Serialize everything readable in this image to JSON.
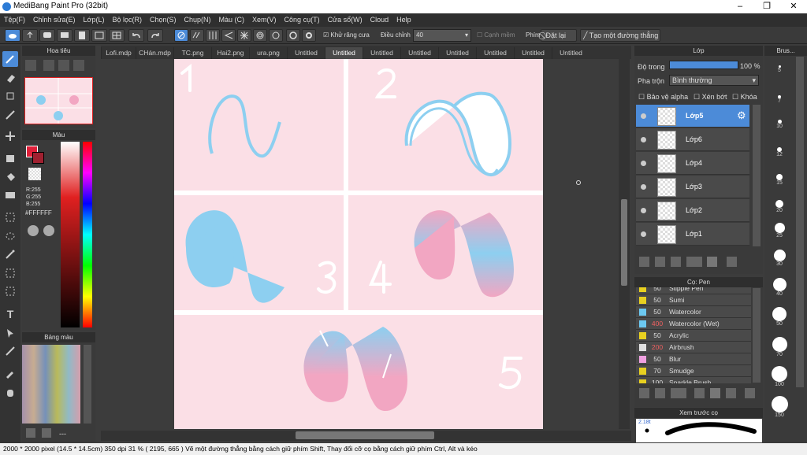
{
  "window": {
    "title": "MediBang Paint Pro (32bit)",
    "minimize": "–",
    "maximize": "❐",
    "close": "✕"
  },
  "menu": [
    "Tệp(F)",
    "Chỉnh sửa(E)",
    "Lớp(L)",
    "Bộ lọc(R)",
    "Chọn(S)",
    "Chụp(N)",
    "Màu (C)",
    "Xem(V)",
    "Công cụ(T)",
    "Cửa sổ(W)",
    "Cloud",
    "Help"
  ],
  "toolbar": {
    "antialias": "Khử răng cưa",
    "correction_label": "Điều chỉnh",
    "correction_value": "40",
    "edge": "Cạnh mềm",
    "keys": "Phím",
    "reset": "Đặt lại",
    "straight": "Tạo một đường thẳng"
  },
  "navigator": {
    "title": "Hoa tiêu"
  },
  "color": {
    "title": "Màu",
    "r": "R:255",
    "g": "G:255",
    "b": "B:255",
    "hex": "#FFFFFF",
    "primary": "#e0203a",
    "secondary": "#ffffff"
  },
  "palette": {
    "title": "Bảng màu",
    "dash": "---"
  },
  "tabs": [
    "Lofi.mdp",
    "CHán.mdp",
    "TC.png",
    "Hai2.png",
    "ura.png",
    "Untitled",
    "Untitled",
    "Untitled",
    "Untitled",
    "Untitled",
    "Untitled",
    "Untitled",
    "Untitled"
  ],
  "canvas": {
    "numbers": [
      "1",
      "2",
      "3",
      "4",
      "5"
    ],
    "colors": {
      "bg": "#fbdfe6",
      "blue": "#8dcff0",
      "pink": "#f2a6c2",
      "white": "#ffffff"
    }
  },
  "layers": {
    "title": "Lớp",
    "opacity_label": "Độ trong",
    "opacity_value": "100 %",
    "blend_label": "Pha trộn",
    "blend_value": "Bình thường",
    "protect_alpha": "Bảo vệ alpha",
    "clipping": "Xén bớt",
    "lock": "Khóa",
    "items": [
      {
        "name": "Lớp5",
        "selected": true
      },
      {
        "name": "Lớp6",
        "selected": false
      },
      {
        "name": "Lớp4",
        "selected": false
      },
      {
        "name": "Lớp3",
        "selected": false
      },
      {
        "name": "Lớp2",
        "selected": false
      },
      {
        "name": "Lớp1",
        "selected": false
      }
    ]
  },
  "brushes": {
    "title": "Cọ: Pen",
    "items": [
      {
        "size": "50",
        "name": "Stipple Pen",
        "color": "#e8d020"
      },
      {
        "size": "50",
        "name": "Sumi",
        "color": "#e8d020"
      },
      {
        "size": "50",
        "name": "Watercolor",
        "color": "#6cc8f0"
      },
      {
        "size": "400",
        "name": "Watercolor (Wet)",
        "color": "#6cc8f0",
        "red": true
      },
      {
        "size": "50",
        "name": "Acrylic",
        "color": "#e8d020"
      },
      {
        "size": "200",
        "name": "Airbrush",
        "color": "#e0e0e0",
        "red": true
      },
      {
        "size": "50",
        "name": "Blur",
        "color": "#f0a0e0"
      },
      {
        "size": "70",
        "name": "Smudge",
        "color": "#e8d020"
      },
      {
        "size": "100",
        "name": "Sparkle Brush",
        "color": "#e8d020"
      }
    ]
  },
  "preview": {
    "title": "Xem trước cọ",
    "size": "2.18t"
  },
  "sizes": {
    "title": "Brus...",
    "items": [
      "5",
      "7",
      "10",
      "12",
      "15",
      "20",
      "25",
      "30",
      "40",
      "50",
      "70",
      "100",
      "150"
    ]
  },
  "status": {
    "text": "2000 * 2000 pixel  (14.5 * 14.5cm)  350 dpi  31 %  ( 2195, 665 )  Vẽ một đường thẳng bằng cách giữ phím Shift, Thay đổi cỡ cọ bằng cách giữ phím Ctrl, Alt và kéo"
  }
}
